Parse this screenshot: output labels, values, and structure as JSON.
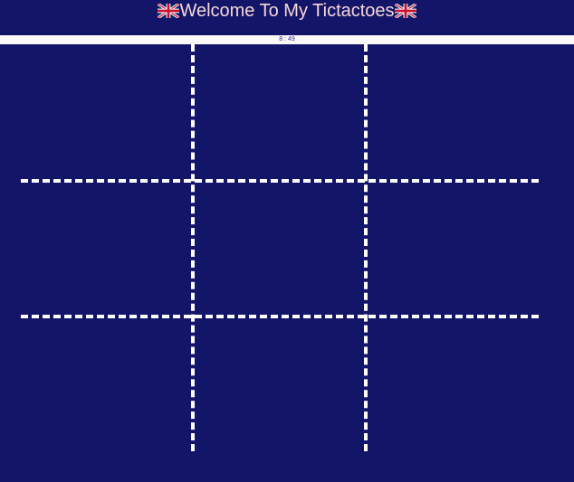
{
  "header": {
    "flag_icon": "uk-flag-icon",
    "title": "Welcome To My Tictactoes"
  },
  "timer": {
    "text": "8 : 49"
  },
  "colors": {
    "background": "#131569",
    "title": "#f7d7d7",
    "timer_bar": "#fbf8f8",
    "grid_lines": "#ffffff"
  },
  "board": {
    "rows": 3,
    "cols": 3,
    "cells": [
      "",
      "",
      "",
      "",
      "",
      "",
      "",
      "",
      ""
    ]
  }
}
